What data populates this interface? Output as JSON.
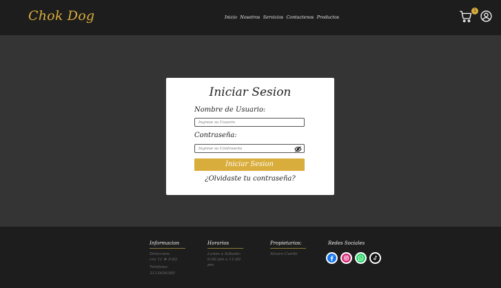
{
  "header": {
    "brand": "Chok Dog",
    "nav": [
      "Inicio",
      "Nosotros",
      "Servicios",
      "Contactenos",
      "Productos"
    ],
    "cart_count": "1"
  },
  "login": {
    "title": "Iniciar Sesion",
    "username_label": "Nombre de Usuario:",
    "username_placeholder": "Ingrese su Usuario",
    "password_label": "Contraseña:",
    "password_placeholder": "Ingrese su Contraseña",
    "submit_label": "Iniciar Sesion",
    "forgot_label": "¿Olvidaste tu contraseña?"
  },
  "footer": {
    "info": {
      "title": "Informacion",
      "address_label": "Direccion:",
      "address": "cra 11 # 0-82",
      "phone_label": "Telefono:",
      "phone": "3112656385"
    },
    "hours": {
      "title": "Horarios",
      "days": "Lunes a Sábado:",
      "time": "6:00 pm a 11:00 pm"
    },
    "owners": {
      "title": "Propietarios:",
      "name": "Alvaro Cuello"
    },
    "social": {
      "title": "Redes Sociales",
      "icons": [
        "facebook-icon",
        "instagram-icon",
        "whatsapp-icon",
        "tiktok-icon"
      ]
    }
  },
  "colors": {
    "accent": "#d9ad3c",
    "header_bg": "#1d1d1d",
    "page_bg": "#343434",
    "facebook": "#1877f2",
    "instagram": "#d62976",
    "whatsapp": "#25d366"
  }
}
